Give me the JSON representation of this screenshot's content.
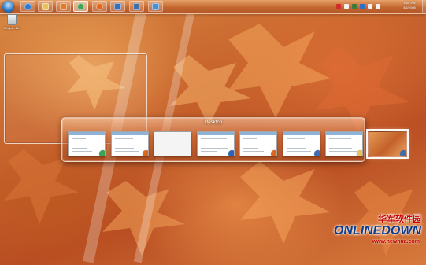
{
  "taskbar": {
    "start_icon": "windows-orb-icon",
    "buttons": [
      {
        "icon": "internet-explorer-icon",
        "color": "#2b7bd0",
        "state": "pinned"
      },
      {
        "icon": "folder-icon",
        "color": "#e8c15a",
        "state": "pinned"
      },
      {
        "icon": "media-player-icon",
        "color": "#e07b2a",
        "state": "pinned"
      },
      {
        "icon": "chrome-icon",
        "color": "#3aa655",
        "state": "active"
      },
      {
        "icon": "firefox-icon",
        "color": "#e0661c",
        "state": "pinned"
      },
      {
        "icon": "control-panel-icon",
        "color": "#3a6db5",
        "state": "pinned"
      },
      {
        "icon": "app-window-icon",
        "color": "#3e6fa8",
        "state": "pinned"
      },
      {
        "icon": "monitor-icon",
        "color": "#4a8fd0",
        "state": "pinned"
      }
    ],
    "tray_icons": [
      {
        "icon": "tray-red-icon",
        "color": "#d42a2a"
      },
      {
        "icon": "tray-network-icon",
        "color": "#f2f2f2"
      },
      {
        "icon": "tray-shield-icon",
        "color": "#3c7a3c"
      },
      {
        "icon": "tray-blue-icon",
        "color": "#2a6ed4"
      },
      {
        "icon": "tray-flag-icon",
        "color": "#f2f2f2"
      },
      {
        "icon": "tray-volume-icon",
        "color": "#f2f2f2"
      }
    ],
    "clock": {
      "time": "4:08 PM",
      "date": "8/5/2008"
    }
  },
  "desktop": {
    "recycle_bin_label": "Recycle Bin"
  },
  "switcher": {
    "title": "Desktop",
    "windows": [
      {
        "name": "chrome-window",
        "badge": "chrome-icon",
        "badge_color": "#3aa655",
        "selected": false
      },
      {
        "name": "firefox-window",
        "badge": "firefox-icon",
        "badge_color": "#e0661c",
        "selected": false
      },
      {
        "name": "blank-window",
        "badge": "",
        "badge_color": "",
        "selected": false
      },
      {
        "name": "browser-window",
        "badge": "app-icon",
        "badge_color": "#2b63b8",
        "selected": false
      },
      {
        "name": "firefox-window-2",
        "badge": "firefox-icon",
        "badge_color": "#e0661c",
        "selected": false
      },
      {
        "name": "control-panel-window",
        "badge": "control-panel-icon",
        "badge_color": "#3a6db5",
        "selected": false
      },
      {
        "name": "explorer-window",
        "badge": "folder-icon",
        "badge_color": "#e8c15a",
        "selected": false
      },
      {
        "name": "desktop-window",
        "badge": "desktop-icon",
        "badge_color": "#3e6fa8",
        "selected": true
      }
    ]
  },
  "watermark": {
    "chinese": "华军软件园",
    "logo": "ONLINEDOWN",
    "url": "www.newhua.com"
  }
}
